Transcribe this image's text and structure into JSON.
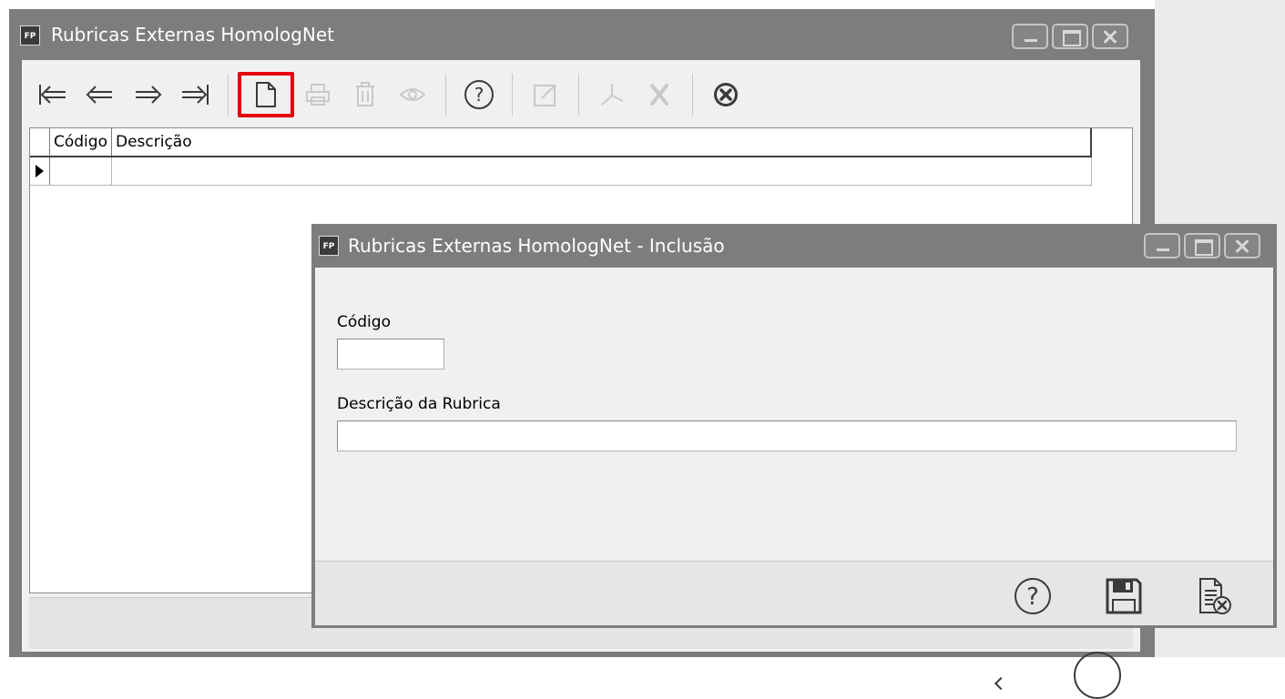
{
  "main_window": {
    "title": "Rubricas Externas HomologNet",
    "icon_label": "FP",
    "grid": {
      "columns": [
        "Código",
        "Descrição"
      ],
      "rows": [
        {
          "codigo": "",
          "descricao": ""
        }
      ]
    },
    "toolbar": [
      {
        "name": "first-record",
        "icon": "first-icon",
        "enabled": true
      },
      {
        "name": "previous-record",
        "icon": "prev-icon",
        "enabled": true
      },
      {
        "name": "next-record",
        "icon": "next-icon",
        "enabled": true
      },
      {
        "name": "last-record",
        "icon": "last-icon",
        "enabled": true
      },
      {
        "name": "new-record",
        "icon": "new-document-icon",
        "enabled": true,
        "highlighted": true
      },
      {
        "name": "print",
        "icon": "print-icon",
        "enabled": false
      },
      {
        "name": "delete",
        "icon": "trash-icon",
        "enabled": false
      },
      {
        "name": "view",
        "icon": "eye-icon",
        "enabled": false
      },
      {
        "name": "help",
        "icon": "help-icon",
        "enabled": true
      },
      {
        "name": "edit",
        "icon": "edit-icon",
        "enabled": false
      },
      {
        "name": "export-pdf",
        "icon": "pdf-icon",
        "enabled": false
      },
      {
        "name": "export-excel",
        "icon": "excel-icon",
        "enabled": false
      },
      {
        "name": "close",
        "icon": "close-circle-icon",
        "enabled": true
      }
    ]
  },
  "dialog": {
    "title": "Rubricas Externas HomologNet - Inclusão",
    "icon_label": "FP",
    "fields": {
      "codigo_label": "Código",
      "codigo_value": "",
      "descricao_label": "Descrição da Rubrica",
      "descricao_value": ""
    },
    "footer_buttons": [
      {
        "name": "help",
        "icon": "help-icon"
      },
      {
        "name": "save",
        "icon": "save-icon"
      },
      {
        "name": "cancel",
        "icon": "cancel-document-icon"
      }
    ]
  },
  "colors": {
    "titlebar": "#7d7d7d",
    "client_bg": "#f0f0f0",
    "highlight": "#e3000f",
    "icon_enabled": "#3a3a3a",
    "icon_disabled": "#c9c9c9"
  }
}
